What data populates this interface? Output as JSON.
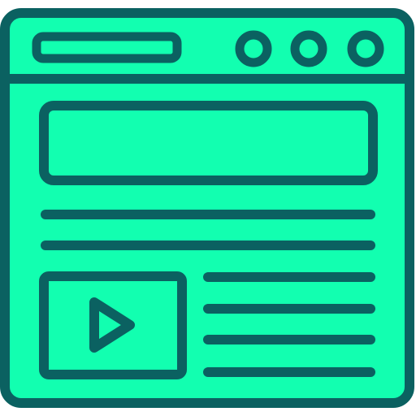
{
  "icon": {
    "name": "web-page-with-video-icon",
    "colors": {
      "fill": "#12ffb0",
      "stroke": "#0b6161"
    },
    "parts": {
      "title_bar": "address-bar",
      "window_buttons": [
        "minimize-button-icon",
        "maximize-button-icon",
        "close-button-icon"
      ],
      "banner": "banner-placeholder",
      "text_lines_full": 2,
      "text_lines_side": 4,
      "media": "video-thumbnail",
      "media_icon": "play-icon"
    }
  }
}
